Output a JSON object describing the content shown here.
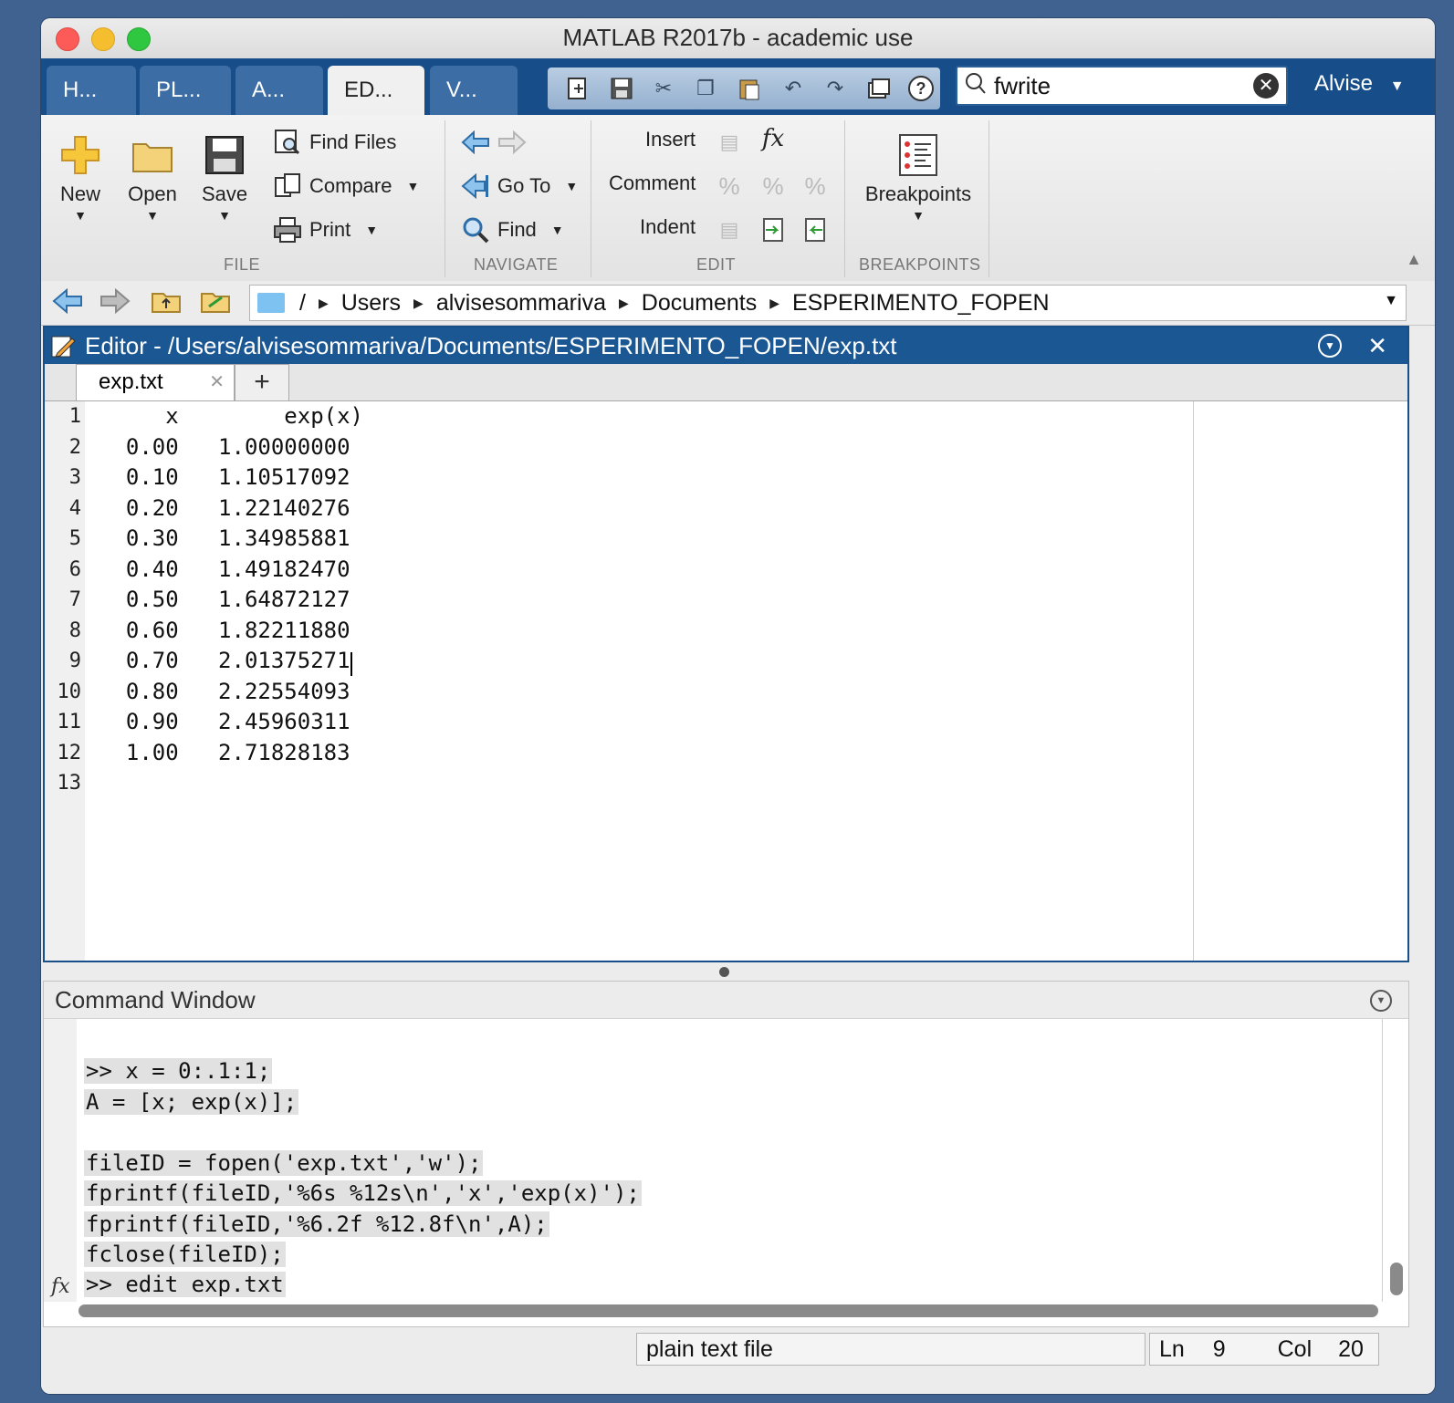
{
  "window": {
    "title": "MATLAB R2017b - academic use"
  },
  "toolstrip_tabs": [
    {
      "label": "H..."
    },
    {
      "label": "PL..."
    },
    {
      "label": "A..."
    },
    {
      "label": "ED...",
      "active": true
    },
    {
      "label": "V..."
    }
  ],
  "search": {
    "value": "fwrite"
  },
  "user": {
    "name": "Alvise",
    "menu_icon": "caret-down-icon"
  },
  "ribbon": {
    "file": {
      "section": "FILE",
      "new": "New",
      "open": "Open",
      "save": "Save",
      "find_files": "Find Files",
      "compare": "Compare",
      "print": "Print"
    },
    "navigate": {
      "section": "NAVIGATE",
      "go_to": "Go To",
      "find": "Find"
    },
    "edit": {
      "section": "EDIT",
      "insert": "Insert",
      "comment": "Comment",
      "indent": "Indent"
    },
    "breakpoints": {
      "section": "BREAKPOINTS",
      "breakpoints": "Breakpoints"
    }
  },
  "address": {
    "root": "/",
    "segments": [
      "Users",
      "alvisesommariva",
      "Documents",
      "ESPERIMENTO_FOPEN"
    ]
  },
  "editor": {
    "title": "Editor - /Users/alvisesommariva/Documents/ESPERIMENTO_FOPEN/exp.txt",
    "tab": "exp.txt",
    "lines": [
      {
        "n": "1",
        "text": "     x        exp(x)"
      },
      {
        "n": "2",
        "text": "  0.00   1.00000000"
      },
      {
        "n": "3",
        "text": "  0.10   1.10517092"
      },
      {
        "n": "4",
        "text": "  0.20   1.22140276"
      },
      {
        "n": "5",
        "text": "  0.30   1.34985881"
      },
      {
        "n": "6",
        "text": "  0.40   1.49182470"
      },
      {
        "n": "7",
        "text": "  0.50   1.64872127"
      },
      {
        "n": "8",
        "text": "  0.60   1.82211880"
      },
      {
        "n": "9",
        "text": "  0.70   2.01375271"
      },
      {
        "n": "10",
        "text": "  0.80   2.22554093"
      },
      {
        "n": "11",
        "text": "  0.90   2.45960311"
      },
      {
        "n": "12",
        "text": "  1.00   2.71828183"
      },
      {
        "n": "13",
        "text": ""
      }
    ]
  },
  "command_window": {
    "title": "Command Window",
    "lines": [
      ">> x = 0:.1:1;",
      "A = [x; exp(x)];",
      "",
      "fileID = fopen('exp.txt','w');",
      "fprintf(fileID,'%6s %12s\\n','x','exp(x)');",
      "fprintf(fileID,'%6.2f %12.8f\\n',A);",
      "fclose(fileID);",
      ">> edit exp.txt"
    ]
  },
  "status": {
    "file_type": "plain text file",
    "ln_label": "Ln",
    "ln": "9",
    "col_label": "Col",
    "col": "20"
  }
}
